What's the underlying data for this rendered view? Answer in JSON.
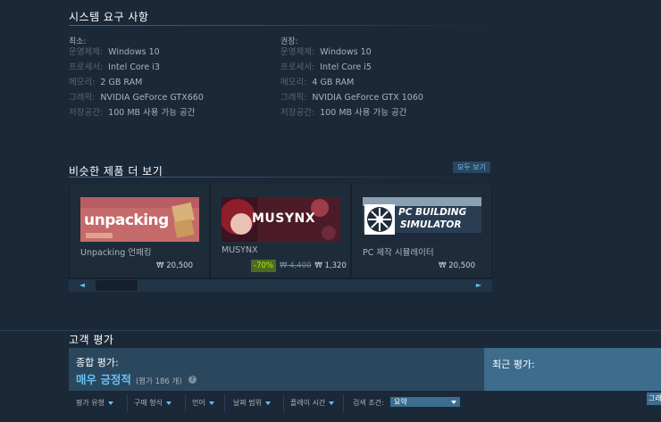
{
  "sysreq": {
    "title": "시스템 요구 사항",
    "minimum": {
      "heading": "최소:",
      "rows": [
        {
          "key": "운영체제:",
          "value": "Windows 10"
        },
        {
          "key": "프로세서:",
          "value": "Intel Core i3"
        },
        {
          "key": "메모리:",
          "value": "2 GB RAM"
        },
        {
          "key": "그래픽:",
          "value": "NVIDIA GeForce GTX660"
        },
        {
          "key": "저장공간:",
          "value": "100 MB 사용 가능 공간"
        }
      ]
    },
    "recommended": {
      "heading": "권장:",
      "rows": [
        {
          "key": "운영체제:",
          "value": "Windows 10"
        },
        {
          "key": "프로세서:",
          "value": "Intel Core i5"
        },
        {
          "key": "메모리:",
          "value": "4 GB RAM"
        },
        {
          "key": "그래픽:",
          "value": "NVIDIA GeForce GTX 1060"
        },
        {
          "key": "저장공간:",
          "value": "100 MB 사용 가능 공간"
        }
      ]
    }
  },
  "similar": {
    "title": "비슷한 제품 더 보기",
    "view_all": "모두 보기",
    "items": [
      {
        "name": "Unpacking 언패킹",
        "capsule_text": "unpacking",
        "price": "₩ 20,500"
      },
      {
        "name": "MUSYNX",
        "capsule_text": "MUSYNX",
        "discount": "-70%",
        "original_price": "₩ 4,400",
        "final_price": "₩ 1,320"
      },
      {
        "name": "PC 제작 시뮬레이터",
        "capsule_text_1": "PC BUILDING",
        "capsule_text_2": "SIMULATOR",
        "price": "₩ 20,500"
      }
    ],
    "scroll_left": "◄",
    "scroll_right": "►"
  },
  "reviews": {
    "title": "고객 평가",
    "overall_label": "종합 평가:",
    "overall_score": "매우 긍정적",
    "overall_count": "(평가 186 개)",
    "help": "?",
    "recent_label": "최근 평가:",
    "filters": [
      "평가 유형",
      "구매 형식",
      "언어",
      "날짜 범위",
      "플레이 시간"
    ],
    "search_label": "검색 조건:",
    "search_value": "요약",
    "edge_button": "그래"
  },
  "colors": {
    "background": "#1b2838",
    "accent": "#67c1f5",
    "discount_green": "#4c6b22",
    "discount_text": "#beee11"
  }
}
